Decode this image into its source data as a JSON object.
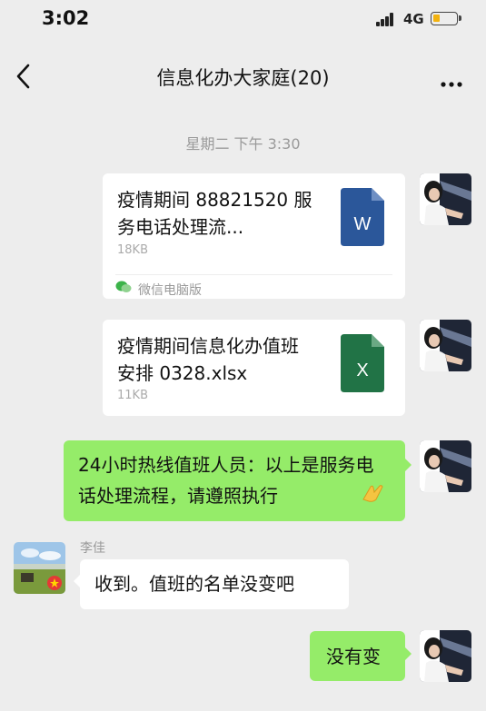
{
  "status_bar": {
    "time": "3:02",
    "network": "4G"
  },
  "header": {
    "title": "信息化办大家庭(20)"
  },
  "timestamp": "星期二 下午 3:30",
  "messages": [
    {
      "type": "file",
      "file_name": "疫情期间 88821520 服务电话处理流...",
      "file_size": "18KB",
      "file_kind": "word",
      "icon_letter": "W",
      "footer": "微信电脑版"
    },
    {
      "type": "file",
      "file_name": "疫情期间信息化办值班安排 0328.xlsx",
      "file_size": "11KB",
      "file_kind": "excel",
      "icon_letter": "X"
    },
    {
      "type": "text",
      "text": "24小时热线值班人员：以上是服务电话处理流程，请遵照执行"
    },
    {
      "type": "text",
      "sender": "李佳",
      "text": "收到。值班的名单没变吧"
    },
    {
      "type": "text",
      "text": "没有变"
    }
  ],
  "colors": {
    "bubble_green": "#95ec69",
    "word_blue": "#2b579a",
    "excel_green": "#217346",
    "background": "#ededed"
  }
}
